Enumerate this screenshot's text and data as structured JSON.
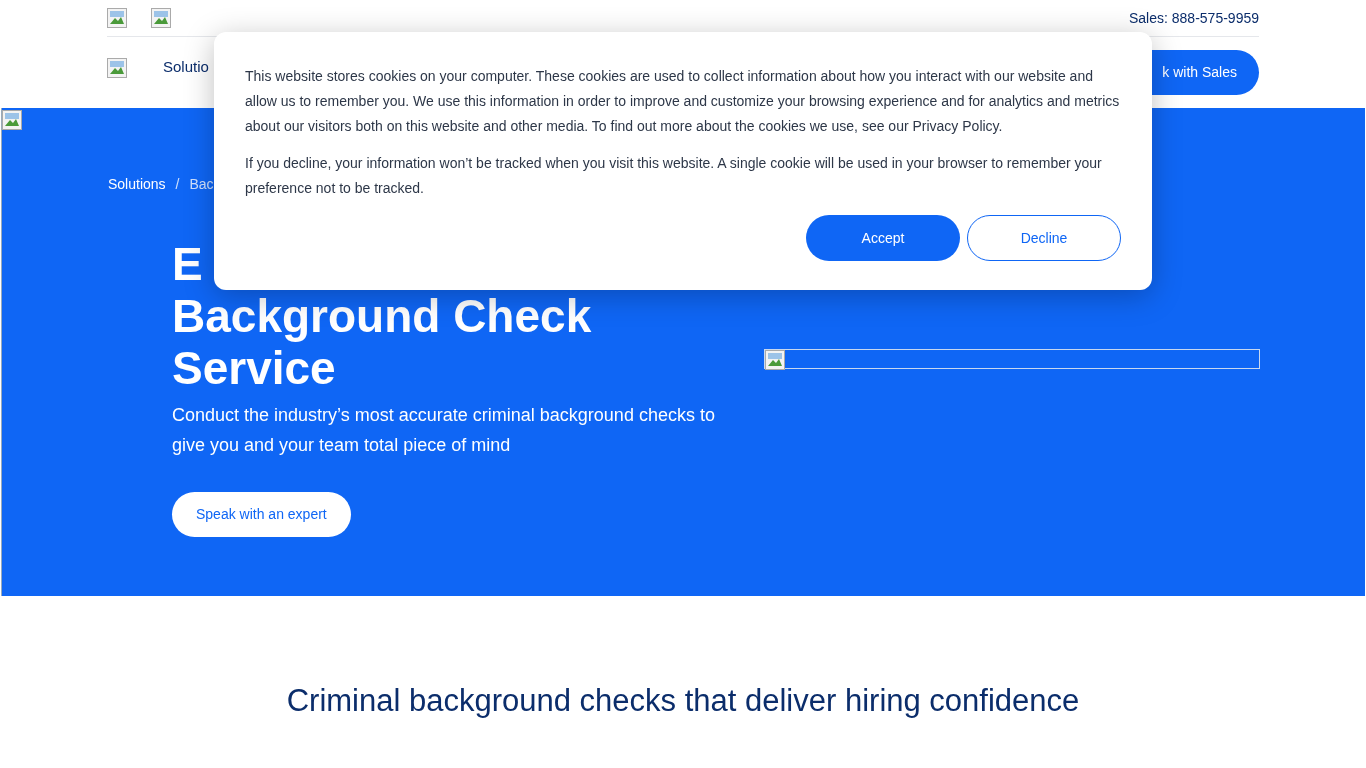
{
  "top_bar": {
    "images": [
      {
        "kind": "broken"
      },
      {
        "kind": "broken"
      }
    ],
    "sales": "Sales: 888-575-9959"
  },
  "nav": {
    "items": [
      "Solutio"
    ],
    "cta": "k with Sales"
  },
  "hero": {
    "breadcrumb": [
      "Solutions",
      "/",
      "Bac"
    ],
    "title_lines": [
      "E",
      "Background Check",
      "Service"
    ],
    "text": "Conduct the industry’s most accurate criminal background checks to give you and your team total piece of mind",
    "button": "Speak with an expert"
  },
  "section_heading": "Criminal background checks that deliver hiring confidence",
  "cookie_dialog": {
    "paragraphs": [
      "This website stores cookies on your computer. These cookies are used to collect information about how you interact with our website and allow us to remember you. We use this information in order to improve and customize your browsing experience and for analytics and metrics about our visitors both on this website and other media. To find out more about the cookies we use, see our Privacy Policy.",
      "If you decline, your information won’t be tracked when you visit this website. A single cookie will be used in your browser to remember your preference not to be tracked."
    ],
    "buttons": [
      {
        "label": "Accept",
        "kind": "primary"
      },
      {
        "label": "Decline",
        "kind": "secondary"
      }
    ]
  }
}
